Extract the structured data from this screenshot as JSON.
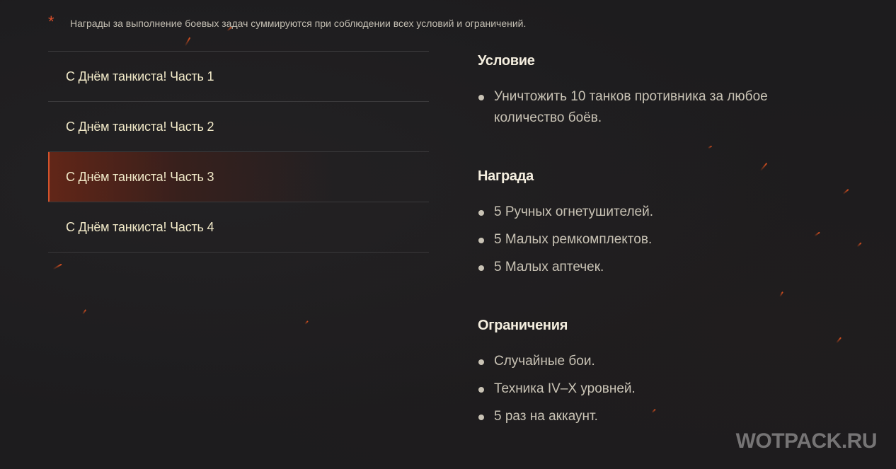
{
  "note": {
    "marker": "*",
    "text": "Награды за выполнение боевых задач суммируются при соблюдении всех условий и ограничений."
  },
  "tabs": [
    {
      "label": "С Днём танкиста! Часть 1",
      "active": false
    },
    {
      "label": "С Днём танкиста! Часть 2",
      "active": false
    },
    {
      "label": "С Днём танкиста! Часть 3",
      "active": true
    },
    {
      "label": "С Днём танкиста! Часть 4",
      "active": false
    }
  ],
  "details": {
    "condition": {
      "title": "Условие",
      "items": [
        "Уничтожить 10 танков противника за любое количество боёв."
      ]
    },
    "reward": {
      "title": "Награда",
      "items": [
        "5 Ручных огнетушителей.",
        "5 Малых ремкомплектов.",
        "5 Малых аптечек."
      ]
    },
    "limits": {
      "title": "Ограничения",
      "items": [
        "Случайные бои.",
        "Техника IV–X уровней.",
        "5 раз на аккаунт."
      ]
    }
  },
  "watermark": "WOTPACK.RU",
  "colors": {
    "background": "#1d1c1e",
    "accent": "#d4532b",
    "tab_text": "#f1e9c8",
    "body_text": "#c9c3b5"
  }
}
